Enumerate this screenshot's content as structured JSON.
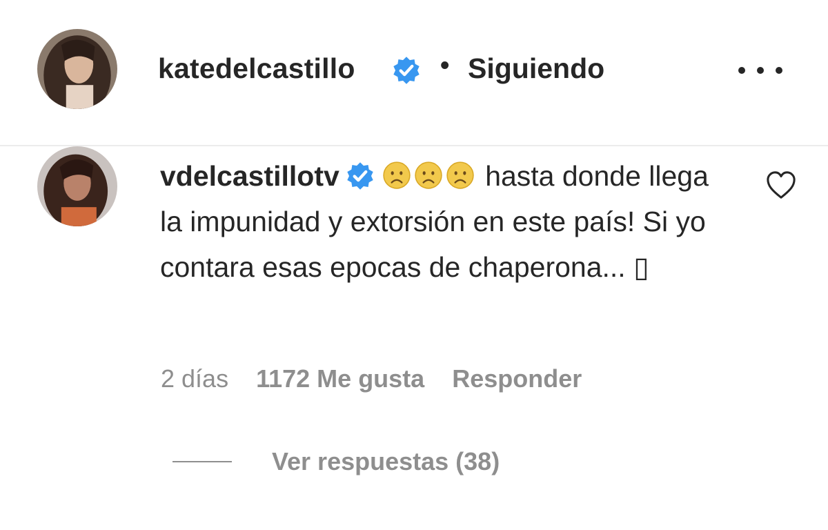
{
  "post": {
    "author": "katedelcastillo",
    "separator": "•",
    "follow_status": "Siguiendo",
    "more_icon": "more-horizontal-icon"
  },
  "comment": {
    "username": "vdelcastillotv",
    "emojis": [
      "worried-face-emoji",
      "worried-face-emoji",
      "worried-face-emoji"
    ],
    "text": "hasta donde llega la impunidad y extorsión en este país! Si yo contara esas epocas de chaperona... ▯",
    "time": "2 días",
    "likes": "1172 Me gusta",
    "reply_label": "Responder",
    "view_replies": "Ver respuestas (38)"
  },
  "colors": {
    "verified": "#3897f0",
    "text": "#262626",
    "muted": "#8e8e8e",
    "divider": "#ececec"
  }
}
